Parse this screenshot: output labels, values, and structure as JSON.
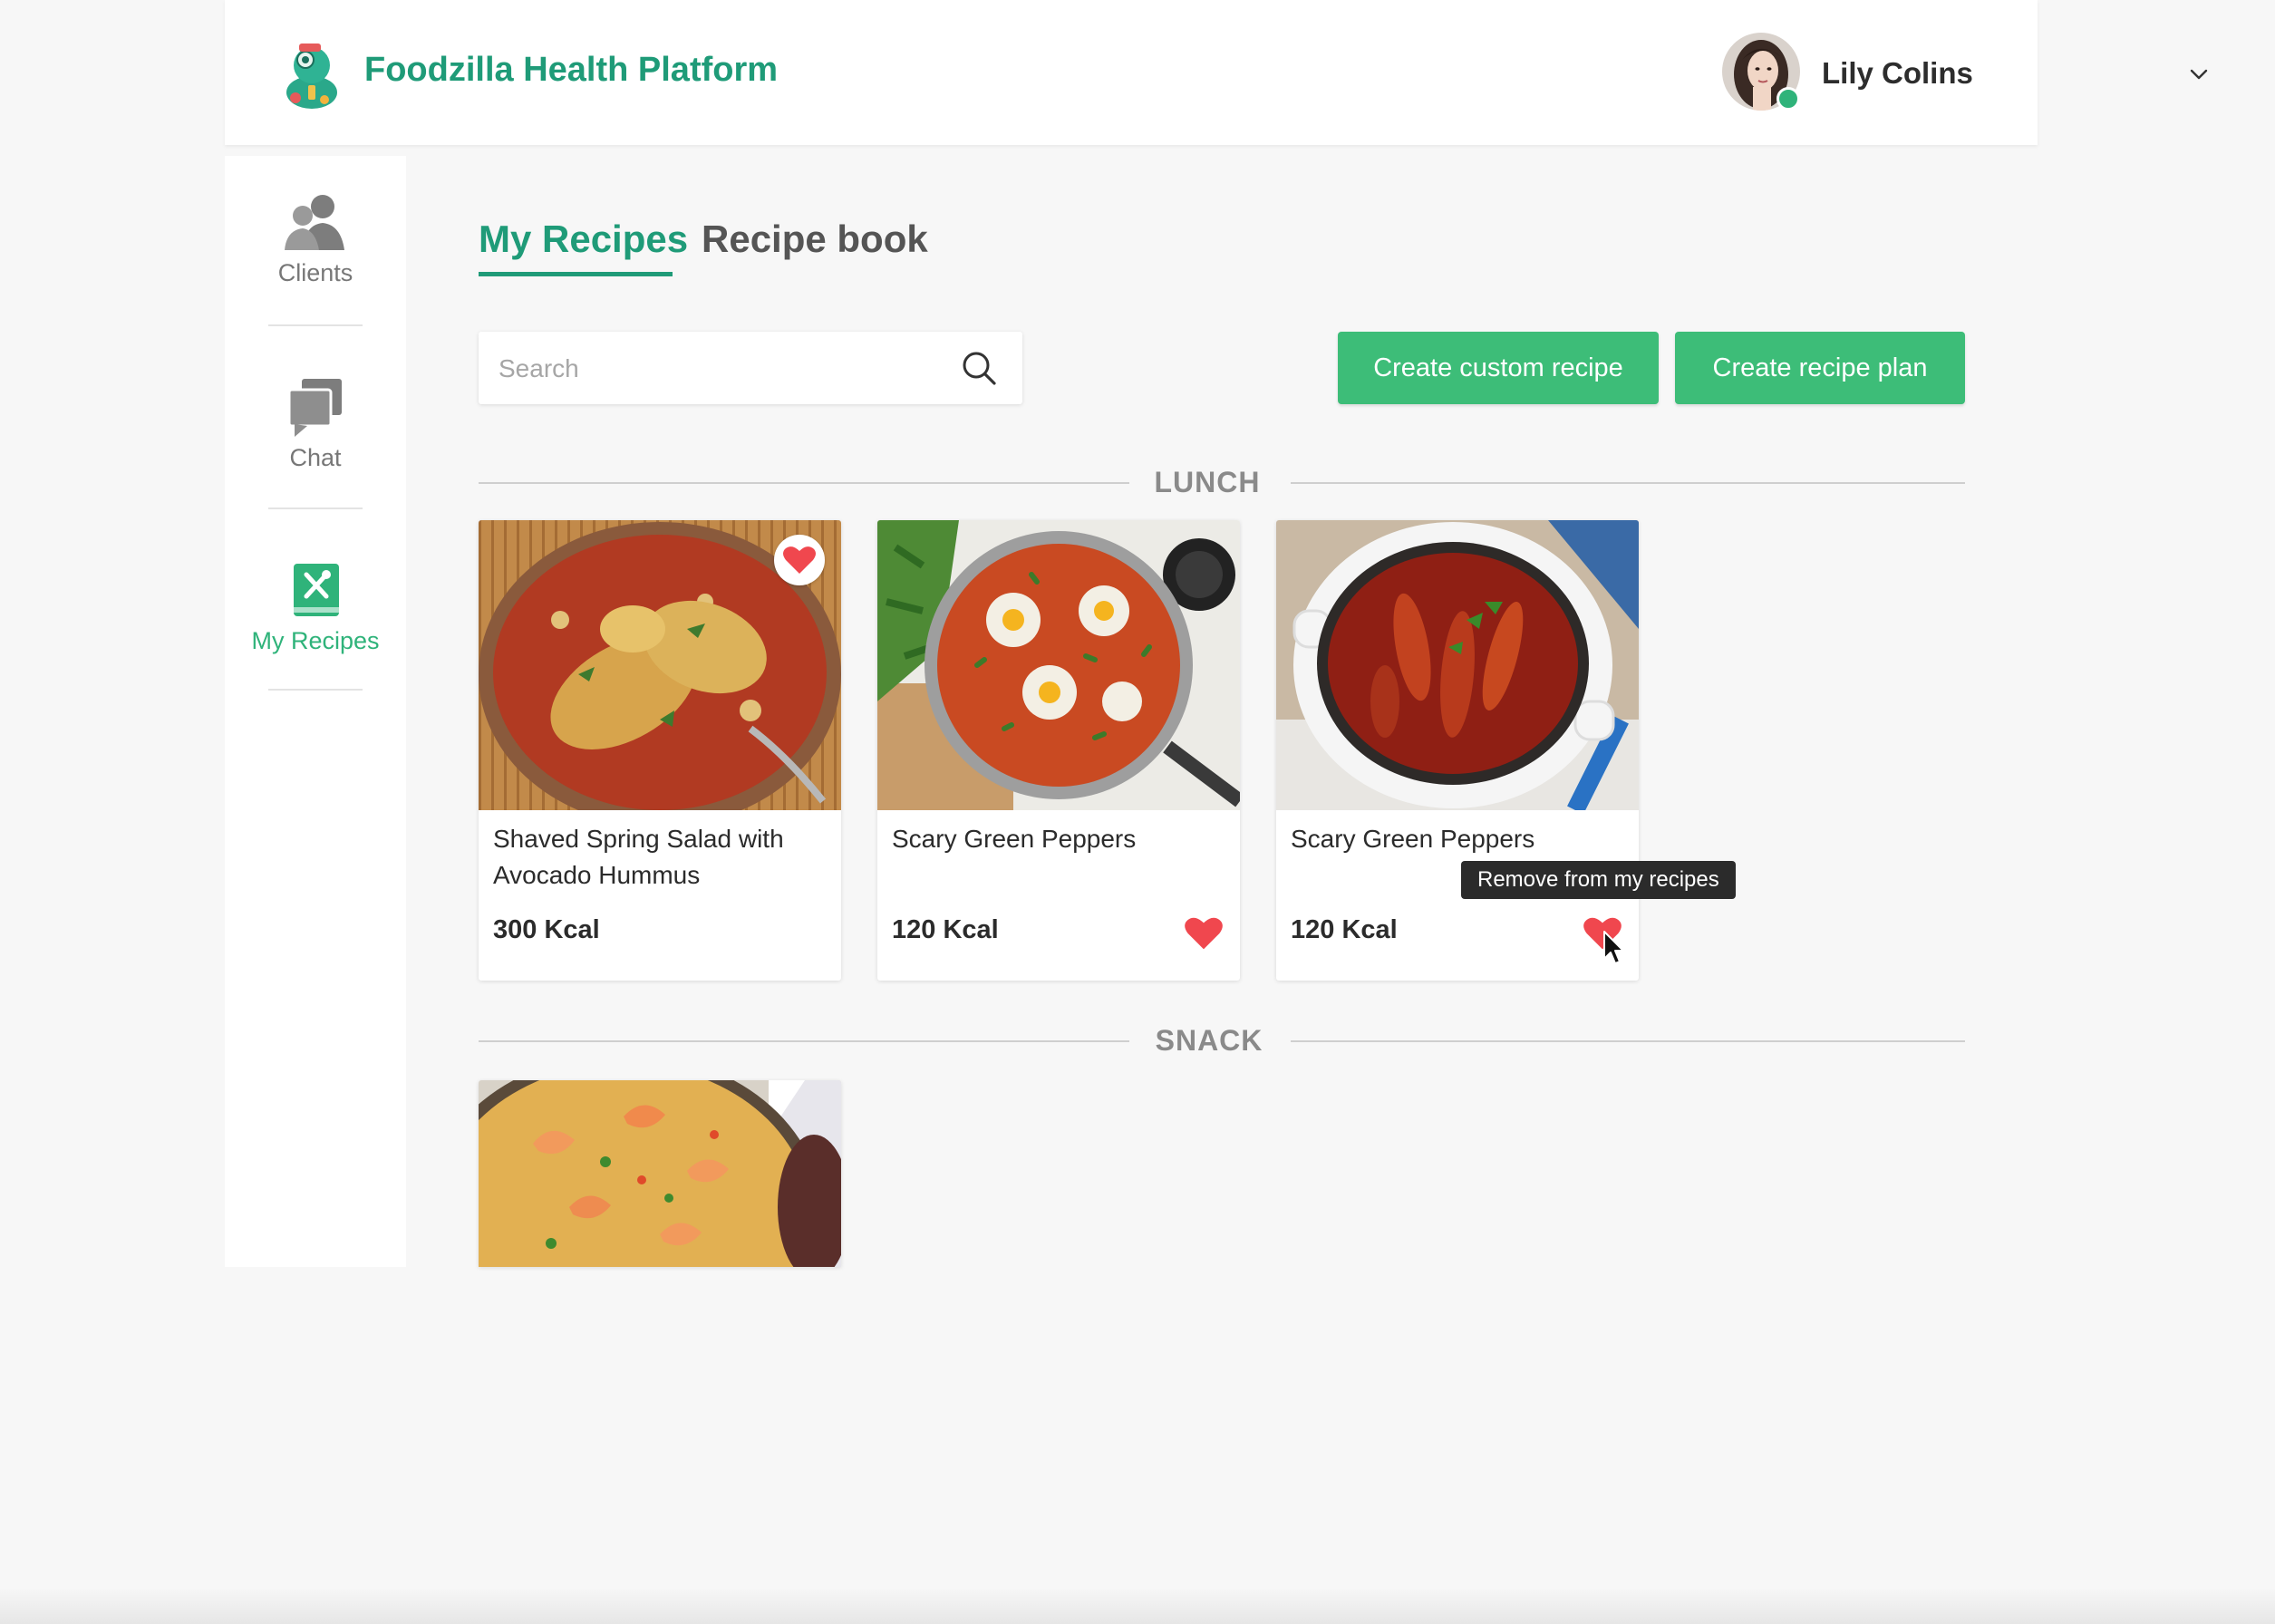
{
  "header": {
    "app_title": "Foodzilla Health Platform",
    "user_name": "Lily Colins",
    "brand_color": "#1f9b78",
    "online_status_color": "#2fb37a"
  },
  "sidebar": {
    "items": [
      {
        "label": "Clients",
        "icon": "clients-icon",
        "active": false
      },
      {
        "label": "Chat",
        "icon": "chat-icon",
        "active": false
      },
      {
        "label": "My Recipes",
        "icon": "recipes-icon",
        "active": true
      }
    ],
    "active_color": "#2fb37a"
  },
  "tabs": [
    {
      "label": "My Recipes",
      "active": true
    },
    {
      "label": "Recipe book",
      "active": false
    }
  ],
  "search": {
    "placeholder": "Search",
    "value": ""
  },
  "actions": {
    "create_custom_recipe": "Create custom recipe",
    "create_recipe_plan": "Create recipe plan",
    "button_color": "#3dbd78"
  },
  "sections": [
    {
      "title": "LUNCH",
      "recipes": [
        {
          "title": "Shaved Spring Salad with Avocado Hummus",
          "kcal": "300 Kcal",
          "favorited": true,
          "image": "chicken-stew-photo"
        },
        {
          "title": "Scary Green Peppers",
          "kcal": "120 Kcal",
          "favorited": true,
          "image": "shakshuka-photo"
        },
        {
          "title": "Scary Green Peppers",
          "kcal": "120 Kcal",
          "favorited": true,
          "image": "pepper-stew-photo"
        }
      ]
    },
    {
      "title": "SNACK",
      "recipes": [
        {
          "title": "",
          "kcal": "",
          "favorited": false,
          "image": "shrimp-pasta-photo"
        }
      ]
    }
  ],
  "tooltip": {
    "text": "Remove from my recipes"
  },
  "heart_color": "#f0474e"
}
